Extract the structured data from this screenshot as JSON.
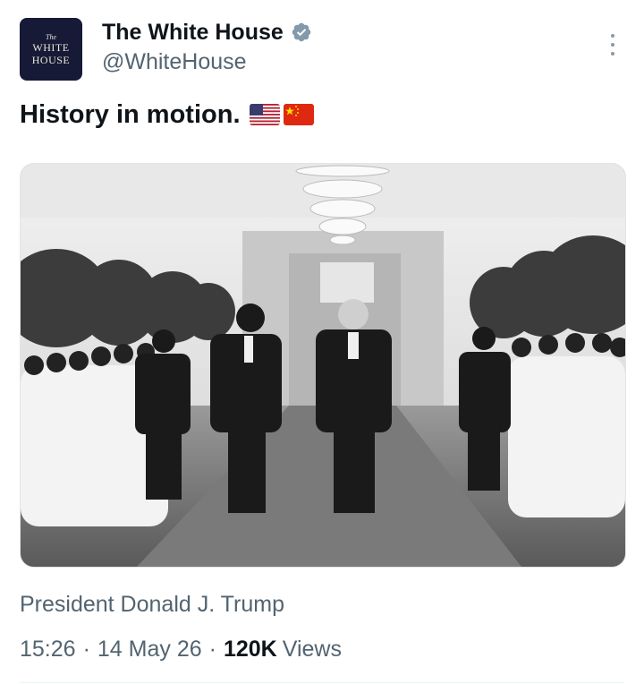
{
  "account": {
    "display_name": "The White House",
    "handle": "@WhiteHouse",
    "avatar_text": {
      "small": "The",
      "line1": "WHITE",
      "line2": "HOUSE"
    },
    "verified": true
  },
  "tweet": {
    "text": "History in motion.",
    "emojis": [
      "us-flag-icon",
      "china-flag-icon"
    ],
    "media_caption": "President Donald J. Trump"
  },
  "meta": {
    "time": "15:26",
    "date": "14 May 26",
    "views_count": "120K",
    "views_label": "Views",
    "separator": "·"
  },
  "colors": {
    "text": "#0f1419",
    "secondary": "#536471",
    "avatar_bg": "#161a36",
    "verified": "#829aab"
  }
}
